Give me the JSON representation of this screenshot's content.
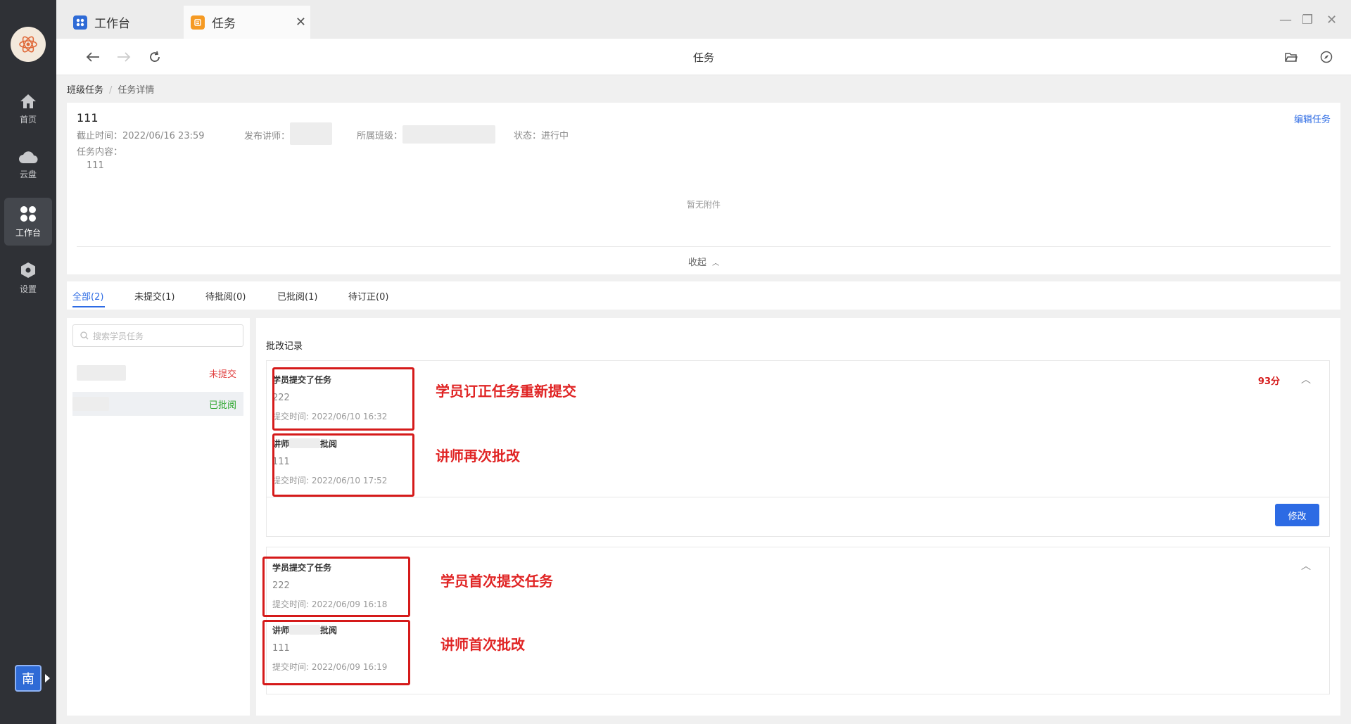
{
  "rail": {
    "items": [
      {
        "label": "首页",
        "icon": "home-icon"
      },
      {
        "label": "云盘",
        "icon": "cloud-icon"
      },
      {
        "label": "工作台",
        "icon": "workbench-icon"
      },
      {
        "label": "设置",
        "icon": "settings-icon"
      }
    ],
    "avatar_text": "南"
  },
  "tabs": [
    {
      "label": "工作台",
      "icon": "workbench-tab-icon",
      "color": "#2f6bd6"
    },
    {
      "label": "任务",
      "icon": "task-tab-icon",
      "color": "#f59a23"
    }
  ],
  "nav": {
    "title": "任务"
  },
  "breadcrumb": {
    "parent": "班级任务",
    "sep": "/",
    "current": "任务详情"
  },
  "task": {
    "title": "111",
    "deadline": "截止时间：2022/06/16 23:59",
    "teacher_label": "发布讲师：",
    "class_label": "所属班级：",
    "status": "状态：进行中",
    "content_label": "任务内容：",
    "content": "111",
    "edit_label": "编辑任务",
    "no_attachment": "暂无附件",
    "collapse_label": "收起"
  },
  "filters": [
    {
      "label": "全部(2)",
      "active": true
    },
    {
      "label": "未提交(1)"
    },
    {
      "label": "待批阅(0)"
    },
    {
      "label": "已批阅(1)"
    },
    {
      "label": "待订正(0)"
    }
  ],
  "search": {
    "placeholder": "搜索学员任务"
  },
  "students": [
    {
      "status": "未提交",
      "status_color": "#e04040"
    },
    {
      "status": "已批阅",
      "status_color": "#2aa52a"
    }
  ],
  "records": {
    "title": "批改记录",
    "group1": {
      "score": "93分",
      "modify_label": "修改",
      "entries": [
        {
          "title": "学员提交了任务",
          "body": "222",
          "time": "提交时间: 2022/06/10 16:32"
        },
        {
          "title_prefix": "讲师",
          "title_suffix": "批阅",
          "body": "111",
          "time": "提交时间: 2022/06/10 17:52"
        }
      ]
    },
    "group2": {
      "entries": [
        {
          "title": "学员提交了任务",
          "body": "222",
          "time": "提交时间: 2022/06/09 16:18"
        },
        {
          "title_prefix": "讲师",
          "title_suffix": "批阅",
          "body": "111",
          "time": "提交时间: 2022/06/09 16:19"
        }
      ]
    }
  },
  "annotations": [
    "学员订正任务重新提交",
    "讲师再次批改",
    "学员首次提交任务",
    "讲师首次批改"
  ],
  "colors": {
    "accent": "#2d6be4",
    "annotation": "#e02424",
    "score": "#d51a1a"
  }
}
